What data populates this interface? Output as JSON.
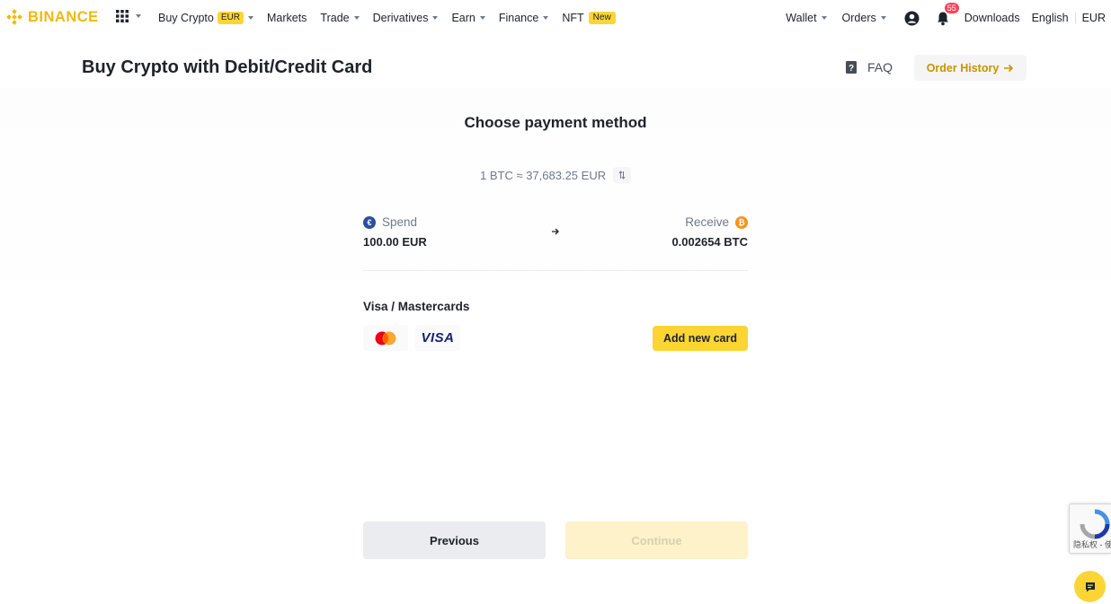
{
  "colors": {
    "brand_yellow": "#f0b90b",
    "button_yellow": "#fcd535",
    "text_primary": "#1e2329",
    "text_secondary": "#707a8a",
    "notification_red": "#f6465d",
    "link_gold": "#c99400"
  },
  "topnav": {
    "logo": "BINANCE",
    "apps_icon": "grid-icon",
    "left_items": [
      {
        "label": "Buy Crypto",
        "badge": "EUR",
        "dropdown": true
      },
      {
        "label": "Markets",
        "dropdown": false
      },
      {
        "label": "Trade",
        "dropdown": true
      },
      {
        "label": "Derivatives",
        "dropdown": true
      },
      {
        "label": "Earn",
        "dropdown": true
      },
      {
        "label": "Finance",
        "dropdown": true
      },
      {
        "label": "NFT",
        "badge": "New",
        "dropdown": false
      }
    ],
    "wallet": "Wallet",
    "orders": "Orders",
    "notification_count": "55",
    "downloads": "Downloads",
    "language": "English",
    "currency": "EUR"
  },
  "header": {
    "title": "Buy Crypto with Debit/Credit Card",
    "faq": "FAQ",
    "order_history": "Order History"
  },
  "payment": {
    "section_title": "Choose payment method",
    "rate": "1 BTC ≈ 37,683.25 EUR",
    "spend_label": "Spend",
    "spend_amount": "100.00 EUR",
    "receive_label": "Receive",
    "receive_amount": "0.002654 BTC",
    "cards_label": "Visa / Mastercards",
    "visa_logo": "VISA",
    "add_card": "Add new card"
  },
  "actions": {
    "previous": "Previous",
    "continue": "Continue"
  },
  "widgets": {
    "recaptcha_text": "隐私权 - 使用条款"
  }
}
